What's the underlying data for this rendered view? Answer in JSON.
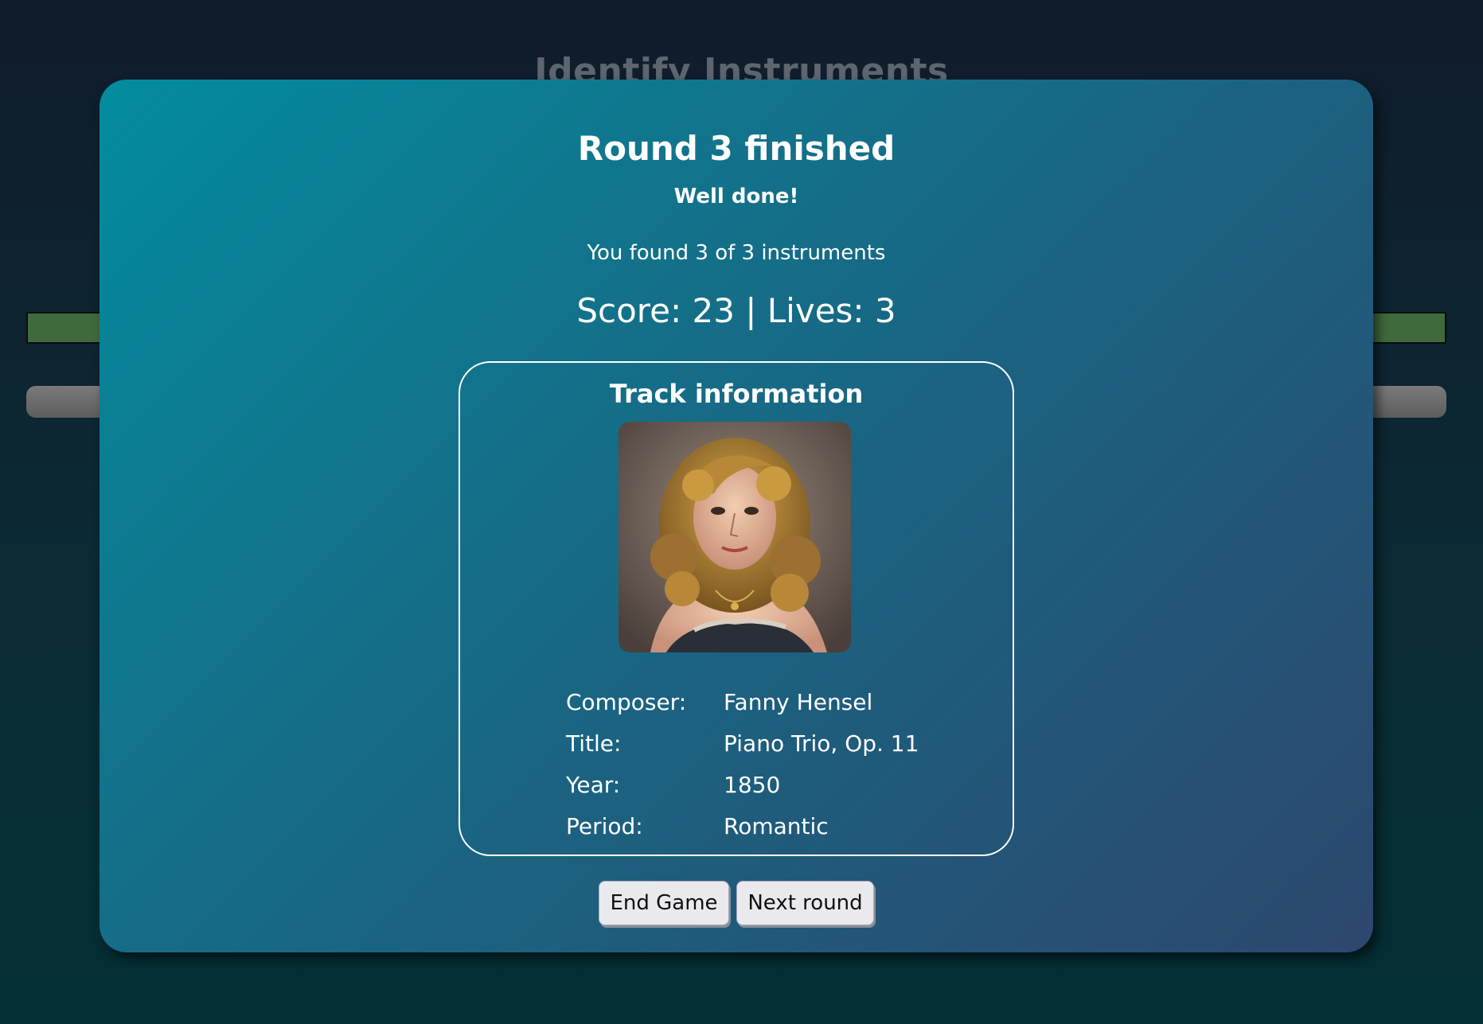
{
  "background": {
    "title": "Identify Instruments"
  },
  "modal": {
    "round_title": "Round 3 finished",
    "subtitle": "Well done!",
    "found_text": "You found 3 of 3 instruments",
    "score_line": "Score: 23 | Lives: 3"
  },
  "track": {
    "heading": "Track information",
    "portrait_icon": "composer-portrait",
    "rows": [
      {
        "label": "Composer:",
        "value": "Fanny Hensel"
      },
      {
        "label": "Title:",
        "value": "Piano Trio, Op. 11"
      },
      {
        "label": "Year:",
        "value": "1850"
      },
      {
        "label": "Period:",
        "value": "Romantic"
      }
    ]
  },
  "buttons": {
    "end_game": "End Game",
    "next_round": "Next round"
  },
  "colors": {
    "modal_gradient_start": "#038c9e",
    "modal_gradient_end": "#2d476e",
    "green_bar": "#3f6a3c"
  }
}
